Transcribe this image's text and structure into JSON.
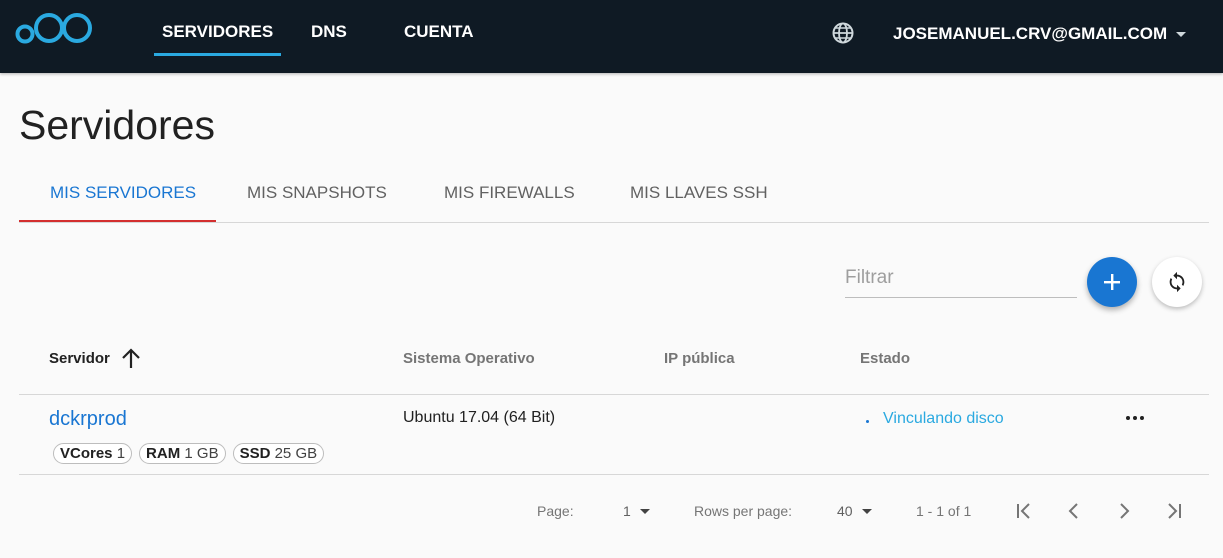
{
  "header": {
    "nav": [
      {
        "label": "SERVIDORES",
        "active": true
      },
      {
        "label": "DNS",
        "active": false
      },
      {
        "label": "CUENTA",
        "active": false
      }
    ],
    "user_email": "JOSEMANUEL.CRV@GMAIL.COM",
    "icons": {
      "logo": "logo",
      "language": "globe-icon",
      "user_menu": "caret-down-icon"
    }
  },
  "page": {
    "title": "Servidores"
  },
  "tabs": [
    {
      "label": "MIS SERVIDORES",
      "active": true
    },
    {
      "label": "MIS SNAPSHOTS",
      "active": false
    },
    {
      "label": "MIS FIREWALLS",
      "active": false
    },
    {
      "label": "MIS LLAVES SSH",
      "active": false
    }
  ],
  "toolbar": {
    "filter_placeholder": "Filtrar",
    "filter_value": "",
    "add_icon": "plus-icon",
    "refresh_icon": "refresh-icon"
  },
  "table": {
    "columns": [
      "Servidor",
      "Sistema Operativo",
      "IP pública",
      "Estado"
    ],
    "sort_column": "Servidor",
    "sort_direction": "ascending",
    "rows": [
      {
        "name": "dckrprod",
        "specs": [
          {
            "label": "VCores",
            "value": "1"
          },
          {
            "label": "RAM",
            "value": "1 GB"
          },
          {
            "label": "SSD",
            "value": "25 GB"
          }
        ],
        "os": "Ubuntu 17.04 (64 Bit)",
        "ip": "",
        "status": "Vinculando disco"
      }
    ]
  },
  "pagination": {
    "page_label": "Page:",
    "page_value": "1",
    "rows_label": "Rows per page:",
    "rows_value": "40",
    "range": "1 - 1 of 1"
  },
  "colors": {
    "header_bg": "#0f1a24",
    "accent_blue": "#1976d2",
    "nav_underline": "#2aa9e0",
    "tab_indicator": "#d32f2f",
    "status": "#2aa9e0"
  }
}
